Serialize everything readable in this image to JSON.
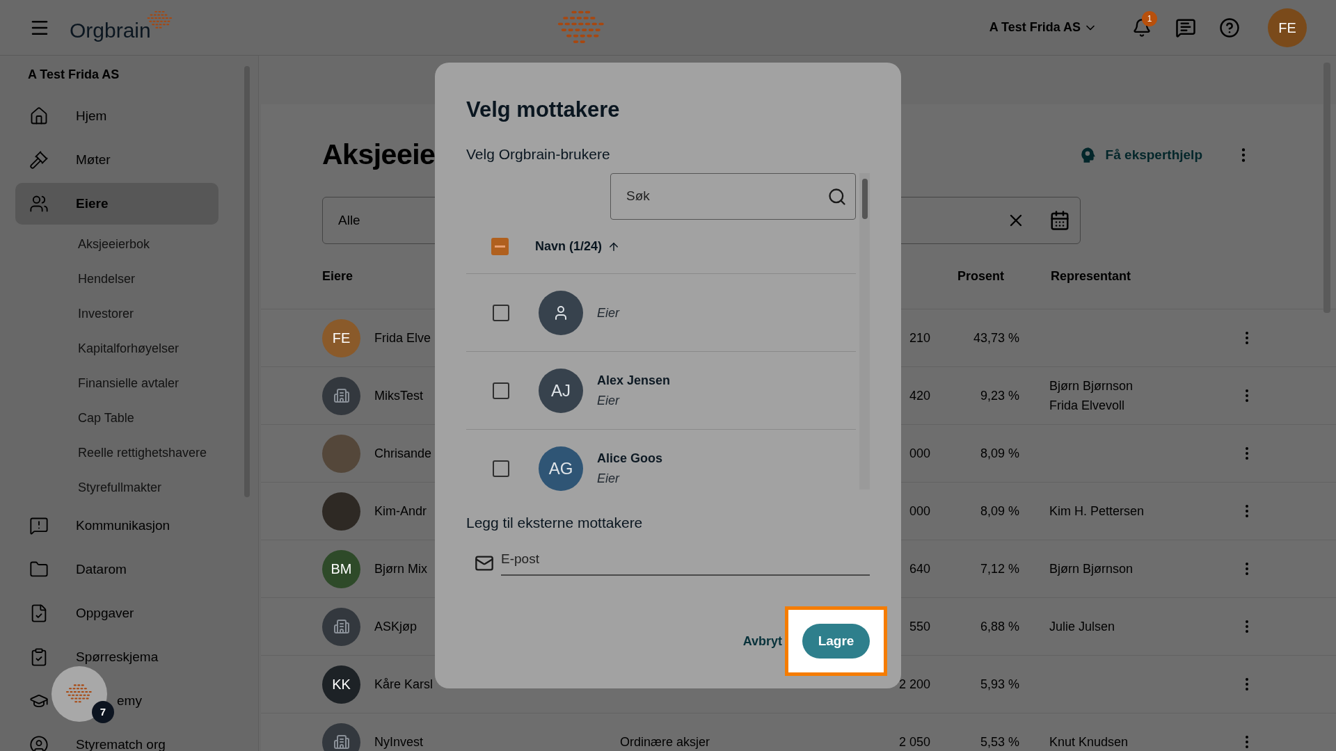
{
  "top_bar": {
    "logo": "Orgbrain",
    "company": "A Test Frida AS",
    "notifications": "1",
    "avatar": "FE"
  },
  "sidebar": {
    "company": "A Test Frida AS",
    "items": [
      {
        "label": "Hjem",
        "selected": false
      },
      {
        "label": "Møter",
        "selected": false
      },
      {
        "label": "Eiere",
        "selected": true,
        "children": [
          {
            "label": "Aksjeeierbok"
          },
          {
            "label": "Hendelser"
          },
          {
            "label": "Investorer"
          },
          {
            "label": "Kapitalforhøyelser"
          },
          {
            "label": "Finansielle avtaler"
          },
          {
            "label": "Cap Table"
          },
          {
            "label": "Reelle rettighetshavere"
          },
          {
            "label": "Styrefullmakter"
          }
        ]
      },
      {
        "label": "Kommunikasjon",
        "selected": false
      },
      {
        "label": "Datarom",
        "selected": false
      },
      {
        "label": "Oppgaver",
        "selected": false
      },
      {
        "label": "Spørreskjema",
        "selected": false
      },
      {
        "label": "emy",
        "selected": false,
        "covered": true
      },
      {
        "label": "Styrematch org",
        "selected": false
      }
    ],
    "chat_badge": "7"
  },
  "page": {
    "title": "Aksjeeie",
    "expert_help": "Få eksperthjelp",
    "filter": {
      "value": "Alle"
    },
    "columns": [
      "Eiere",
      "Prosent",
      "Representant"
    ],
    "rows": [
      {
        "kind": "initials",
        "avatar": "FE",
        "color": "#8a5a2a",
        "name": "Frida Elve",
        "amount": "210",
        "percent": "43,73 %"
      },
      {
        "kind": "company",
        "color": "#33383e",
        "name": "MiksTest",
        "amount": "420",
        "percent": "9,23 %",
        "representatives": [
          "Bjørn Bjørnson",
          "Frida Elvevoll"
        ]
      },
      {
        "kind": "photo",
        "color": "#54473a",
        "name": "Chrisande",
        "amount": "000",
        "percent": "8,09 %"
      },
      {
        "kind": "photo",
        "color": "#2e2924",
        "name": "Kim-Andr",
        "amount": "000",
        "percent": "8,09 %",
        "representatives": [
          "Kim H. Pettersen"
        ]
      },
      {
        "kind": "initials",
        "avatar": "BM",
        "color": "#2e4a29",
        "name": "Bjørn Mix",
        "amount": "640",
        "percent": "7,12 %",
        "representatives": [
          "Bjørn Bjørnson"
        ]
      },
      {
        "kind": "company",
        "color": "#33383e",
        "name": "ASKjøp",
        "amount": "550",
        "percent": "6,88 %",
        "representatives": [
          "Julie Julsen"
        ]
      },
      {
        "kind": "initials",
        "avatar": "KK",
        "color": "#1d2226",
        "name": "Kåre Karsl",
        "amount": "2 200",
        "percent": "5,93 %"
      },
      {
        "kind": "company",
        "color": "#33383e",
        "name": "NyInvest",
        "type": "Ordinære aksjer",
        "amount": "2 050",
        "percent": "5,53 %",
        "representatives": [
          "Knut Knudsen"
        ]
      }
    ]
  },
  "dialog": {
    "title": "Velg mottakere",
    "section": "Velg Orgbrain-brukere",
    "search": {
      "placeholder": "Søk"
    },
    "header": {
      "label": "Navn (1/24)",
      "indeterminate": true
    },
    "users": [
      {
        "kind": "placeholder",
        "color": "#37424d",
        "role": "Eier",
        "checked": false
      },
      {
        "kind": "initials",
        "initials": "AJ",
        "color": "#37424d",
        "name": "Alex Jensen",
        "role": "Eier",
        "checked": false
      },
      {
        "kind": "initials",
        "initials": "AG",
        "color": "#2f5575",
        "name": "Alice Goos",
        "role": "Eier",
        "checked": false
      }
    ],
    "external": "Legg til eksterne mottakere",
    "email": {
      "placeholder": "E-post"
    },
    "cancel": "Avbryt",
    "save": "Lagre"
  }
}
